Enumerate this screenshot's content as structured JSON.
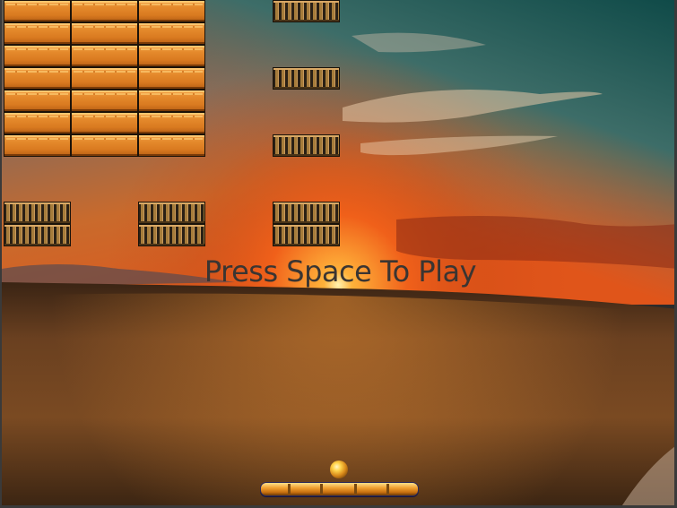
{
  "game": {
    "message": "Press Space To Play",
    "bricks": {
      "orange_rows": 7,
      "orange_columns": 3,
      "metal_positions": "column-5 rows 1,4,7,10,11; columns 1 and 3 rows 10,11"
    },
    "colors": {
      "brick_orange": "#e58a2c",
      "brick_metal": "#a67c3b",
      "paddle": "#f0a030",
      "ball": "#ffd34a",
      "message_text": "#3a3532"
    },
    "icons": [
      "paddle-icon",
      "ball-icon"
    ]
  }
}
